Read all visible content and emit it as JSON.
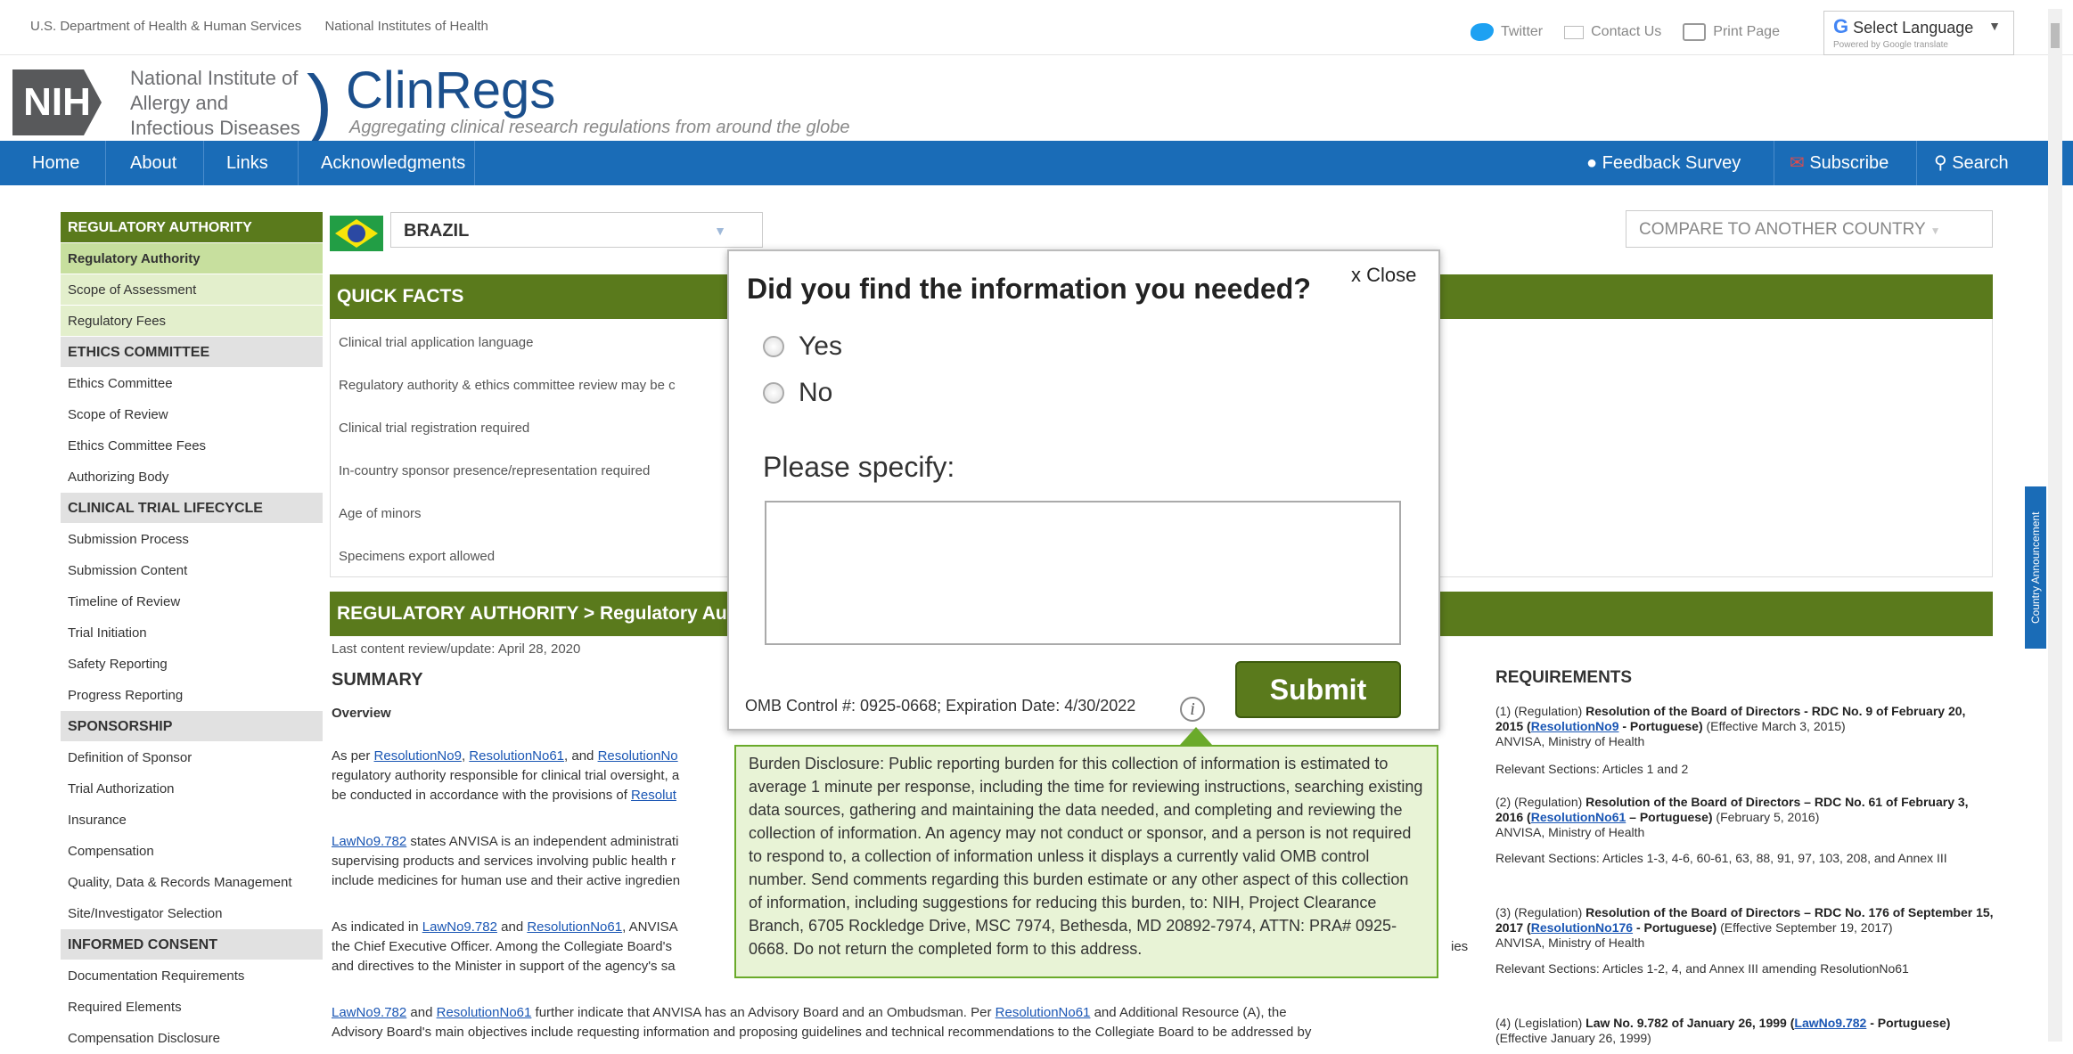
{
  "topbar": {
    "gov1": "U.S. Department of Health & Human Services",
    "gov2": "National Institutes of Health",
    "twitter": "Twitter",
    "contact": "Contact Us",
    "print": "Print Page",
    "lang_label": "Select Language",
    "lang_powered": "Powered by Google translate"
  },
  "header": {
    "nih": "NIH",
    "inst1": "National Institute of",
    "inst2": "Allergy and",
    "inst3": "Infectious Diseases",
    "title": "ClinRegs",
    "tagline": "Aggregating clinical research regulations from around the globe"
  },
  "nav": {
    "home": "Home",
    "about": "About",
    "links": "Links",
    "ack": "Acknowledgments",
    "feedback": "Feedback Survey",
    "subscribe": "Subscribe",
    "search": "Search"
  },
  "sidebar": [
    {
      "label": "REGULATORY AUTHORITY",
      "kind": "hdr"
    },
    {
      "label": "Regulatory Authority",
      "kind": "gsel"
    },
    {
      "label": "Scope of Assessment",
      "kind": "glight"
    },
    {
      "label": "Regulatory Fees",
      "kind": "glight"
    },
    {
      "label": "ETHICS COMMITTEE",
      "kind": "sec"
    },
    {
      "label": "Ethics Committee",
      "kind": "plain"
    },
    {
      "label": "Scope of Review",
      "kind": "plain"
    },
    {
      "label": "Ethics Committee Fees",
      "kind": "plain"
    },
    {
      "label": "Authorizing Body",
      "kind": "plain"
    },
    {
      "label": "CLINICAL TRIAL LIFECYCLE",
      "kind": "sec"
    },
    {
      "label": "Submission Process",
      "kind": "plain"
    },
    {
      "label": "Submission Content",
      "kind": "plain"
    },
    {
      "label": "Timeline of Review",
      "kind": "plain"
    },
    {
      "label": "Trial Initiation",
      "kind": "plain"
    },
    {
      "label": "Safety Reporting",
      "kind": "plain"
    },
    {
      "label": "Progress Reporting",
      "kind": "plain"
    },
    {
      "label": "SPONSORSHIP",
      "kind": "sec"
    },
    {
      "label": "Definition of Sponsor",
      "kind": "plain"
    },
    {
      "label": "Trial Authorization",
      "kind": "plain"
    },
    {
      "label": "Insurance",
      "kind": "plain"
    },
    {
      "label": "Compensation",
      "kind": "plain"
    },
    {
      "label": "Quality, Data & Records Management",
      "kind": "plain"
    },
    {
      "label": "Site/Investigator Selection",
      "kind": "plain"
    },
    {
      "label": "INFORMED CONSENT",
      "kind": "sec"
    },
    {
      "label": "Documentation Requirements",
      "kind": "plain"
    },
    {
      "label": "Required Elements",
      "kind": "plain"
    },
    {
      "label": "Compensation Disclosure",
      "kind": "plain"
    }
  ],
  "content": {
    "country": "BRAZIL",
    "compare": "COMPARE TO ANOTHER COUNTRY",
    "quick_facts": "QUICK FACTS",
    "qf": [
      "Clinical trial application language",
      "Regulatory authority & ethics committee review may be c",
      "Clinical trial registration required",
      "In-country sponsor presence/representation required",
      "Age of minors",
      "Specimens export allowed"
    ],
    "ra_title": "REGULATORY AUTHORITY > Regulatory Aut",
    "review": "Last content review/update: April 28, 2020",
    "summary": "SUMMARY",
    "overview": "Overview",
    "p1a": "As per ",
    "p1_link1": "ResolutionNo9",
    "p1_sep1": ", ",
    "p1_link2": "ResolutionNo61",
    "p1_and": ", and ",
    "p1_link3": "ResolutionNo",
    "p1_line2": "regulatory authority responsible for clinical trial oversight, a",
    "p1_line3a": "be conducted in accordance with the provisions of ",
    "p1_line3_link": "Resolut",
    "p2_link": "LawNo9.782",
    "p2a": " states ANVISA is an independent administrati",
    "p2_line2": "supervising products and services involving public health r",
    "p2_line3": "include medicines for human use and their active ingredien",
    "p3a": "As indicated in ",
    "p3_link1": "LawNo9.782",
    "p3_and": " and ",
    "p3_link2": "ResolutionNo61",
    "p3b": ", ANVISA",
    "p3_line2": "the Chief Executive Officer. Among the Collegiate Board's",
    "p3_line2_end": "ies",
    "p3_line3": "and directives to the Minister in support of the agency's sa",
    "p4_link1": "LawNo9.782",
    "p4_and": " and ",
    "p4_link2": "ResolutionNo61",
    "p4b": " further indicate that ANVISA has an Advisory Board and an Ombudsman. Per ",
    "p4_link3": "ResolutionNo61",
    "p4c": " and Additional Resource (A), the",
    "p4_line2": "Advisory Board's main objectives include requesting information and proposing guidelines and technical recommendations to the Collegiate Board to be addressed by"
  },
  "requirements": {
    "title": "REQUIREMENTS",
    "r1a": "(1) (Regulation) ",
    "r1b": "Resolution of the Board of Directors - RDC No. 9 of February 20, 2015 (",
    "r1_link": "ResolutionNo9",
    "r1c": " - Portuguese)",
    "r1d": " (Effective March 3, 2015)",
    "r1e": "ANVISA, Ministry of Health",
    "r1f": "Relevant Sections: Articles 1 and 2",
    "r2a": "(2) (Regulation) ",
    "r2b": "Resolution of the Board of Directors – RDC No. 61 of February 3, 2016 (",
    "r2_link": "ResolutionNo61",
    "r2c": " – Portuguese)",
    "r2d": " (February 5, 2016)",
    "r2e": "ANVISA, Ministry of Health",
    "r2f": "Relevant Sections: Articles 1-3, 4-6, 60-61, 63, 88, 91, 97, 103, 208, and Annex III",
    "r3a": "(3) (Regulation) ",
    "r3b": "Resolution of the Board of Directors – RDC No. 176 of September 15, 2017 (",
    "r3_link": "ResolutionNo176",
    "r3c": " - Portuguese)",
    "r3d": " (Effective September 19, 2017)",
    "r3e": "ANVISA, Ministry of Health",
    "r3f": "Relevant Sections: Articles 1-2, 4, and Annex III amending ResolutionNo61",
    "r4a": "(4) (Legislation) ",
    "r4b": "Law No. 9.782 of January 26, 1999 (",
    "r4_link": "LawNo9.782",
    "r4c": " - Portuguese)",
    "r4d": " (Effective January 26, 1999)"
  },
  "side_tab": "Country Announcement",
  "modal": {
    "question": "Did you find the information you needed?",
    "close": "x Close",
    "yes": "Yes",
    "no": "No",
    "specify": "Please specify:",
    "omb": "OMB Control #: 0925-0668; Expiration Date: 4/30/2022",
    "info": "i",
    "submit": "Submit",
    "burden": "Burden Disclosure: Public reporting burden for this collection of information is estimated to average 1 minute per response, including the time for reviewing instructions, searching existing data sources, gathering and maintaining the data needed, and completing and reviewing the collection of information. An agency may not conduct or sponsor, and a person is not required to respond to, a collection of information unless it displays a currently valid OMB control number. Send comments regarding this burden estimate or any other aspect of this collection of information, including suggestions for reducing this burden, to: NIH, Project Clearance Branch, 6705 Rockledge Drive, MSC 7974, Bethesda, MD 20892-7974, ATTN: PRA# 0925-0668. Do not return the completed form to this address."
  }
}
